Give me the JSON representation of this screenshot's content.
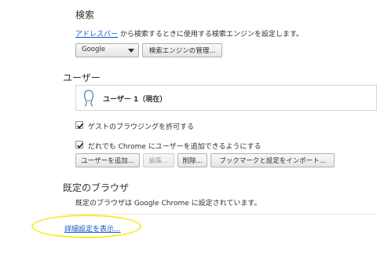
{
  "search": {
    "heading": "検索",
    "omnibox_link": "アドレスバー",
    "description_suffix": " から検索するときに使用する検索エンジンを設定します。",
    "engine_selected": "Google",
    "manage_button": "検索エンジンの管理..."
  },
  "users": {
    "heading": "ユーザー",
    "current_user": "ユーザー 1（現在）",
    "guest_checkbox": {
      "label": "ゲストのブラウジングを許可する",
      "checked": true
    },
    "anyone_checkbox": {
      "label": "だれでも Chrome にユーザーを追加できるようにする",
      "checked": true
    },
    "add_button": "ユーザーを追加...",
    "edit_button": "編集...",
    "delete_button": "削除...",
    "import_button": "ブックマークと設定をインポート..."
  },
  "default_browser": {
    "heading": "既定のブラウザ",
    "status": "既定のブラウザは Google Chrome に設定されています。"
  },
  "advanced_link": "詳細設定を表示...",
  "colors": {
    "link": "#1155cc",
    "highlight": "#f5ee2a"
  }
}
